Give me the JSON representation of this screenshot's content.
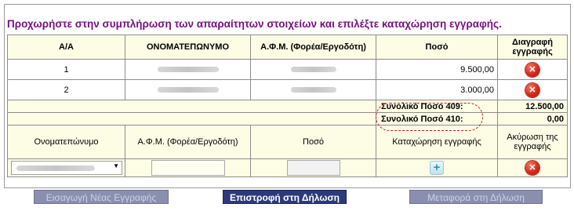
{
  "instruction": "Προχωρήστε στην συμπλήρωση των απαραίτητων στοιχείων και επιλέξτε καταχώρηση εγγραφής.",
  "table": {
    "headers": {
      "index": "Α/Α",
      "name": "ΟΝΟΜΑΤΕΠΩΝΥΜΟ",
      "afm": "Α.Φ.Μ. (Φορέα/Εργοδότη)",
      "amount": "Ποσό",
      "delete": "Διαγραφή εγγραφής"
    },
    "rows": [
      {
        "index": "1",
        "amount": "9.500,00"
      },
      {
        "index": "2",
        "amount": "3.000,00"
      }
    ],
    "totals": [
      {
        "label": "Συνολικό Ποσό 409:",
        "value": "12.500,00"
      },
      {
        "label": "Συνολικό Ποσό 410:",
        "value": "0,00"
      }
    ]
  },
  "entry_form": {
    "headers": {
      "name": "Ονοματεπώνυμο",
      "afm": "Α.Φ.Μ. (Φορέα/Εργοδότη)",
      "amount": "Ποσό",
      "register": "Καταχώρηση εγγραφής",
      "cancel": "Ακύρωση της εγγραφής"
    }
  },
  "buttons": {
    "new_entry": "Εισαγωγή Νέας Εγγραφής",
    "return": "Επιστροφή στη Δήλωση",
    "transfer": "Μεταφορά στη Δήλωση"
  },
  "icons": {
    "delete": "delete-icon",
    "add": "add-icon",
    "dropdown": "chevron-down-icon"
  },
  "colors": {
    "instruction_text": "#7b0f86",
    "header_bg": "#fdfde6",
    "highlight_oval": "#d01818",
    "active_button": "#2c3a7c",
    "disabled_button": "#8a8fb0"
  }
}
